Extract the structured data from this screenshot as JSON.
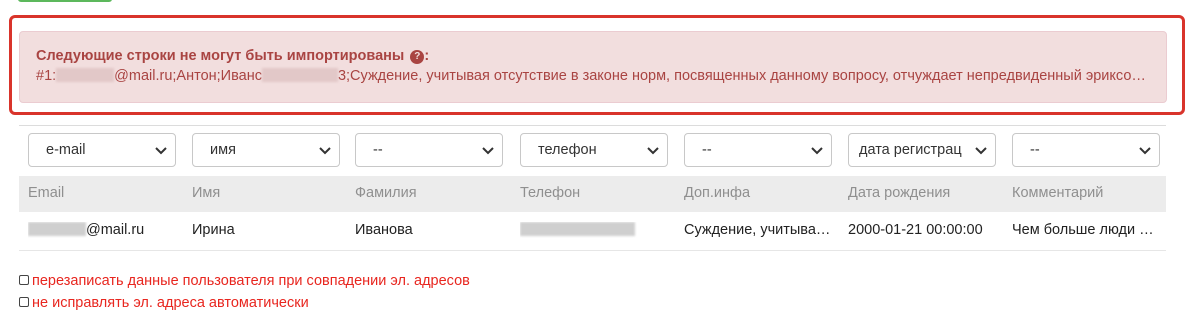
{
  "alert": {
    "title": "Следующие строки не могут быть импортированы",
    "title_suffix": ":",
    "row_prefix": "#1:",
    "row_email_tail": "@mail.ru;Антон;Иванс",
    "row_after_blur": "3;Суждение, учитывая отсутствие в законе норм, посвященных данному вопросу, отчуждает непредвиденный эриксоновс..."
  },
  "selects": [
    {
      "value": "e-mail"
    },
    {
      "value": "имя"
    },
    {
      "value": "--"
    },
    {
      "value": "телефон"
    },
    {
      "value": "--"
    },
    {
      "value": "дата регистрац"
    },
    {
      "value": "--"
    }
  ],
  "table": {
    "headers": [
      "Email",
      "Имя",
      "Фамилия",
      "Телефон",
      "Доп.инфа",
      "Дата рождения",
      "Комментарий"
    ],
    "row": {
      "email_tail": "@mail.ru",
      "first_name": "Ирина",
      "last_name": "Иванова",
      "extra": "Суждение, учитывая отсутствие в законе норм, посвященных данному вопросу",
      "birth_date": "2000-01-21 00:00:00",
      "comment": "Чем больше люди узнают"
    }
  },
  "options": {
    "overwrite_label": "перезаписать данные пользователя при совпадении эл. адресов",
    "no_fix_label": "не исправлять эл. адреса автоматически"
  },
  "colors": {
    "alert_bg": "#f2dede",
    "alert_text": "#a94442",
    "highlight": "#d9342b",
    "option_text": "#e8261f"
  }
}
